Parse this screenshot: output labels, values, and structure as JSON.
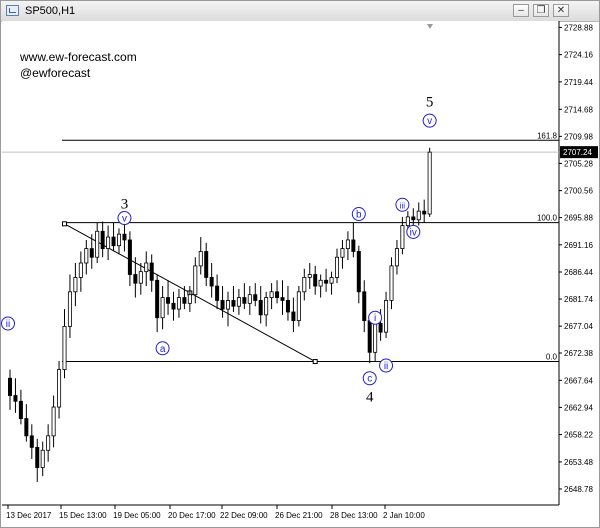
{
  "window": {
    "title": "SP500,H1",
    "buttons": {
      "minimize": "–",
      "restore": "❐",
      "close": "✕"
    }
  },
  "watermark": {
    "line1": "www.ew-forecast.com",
    "line2": "@ewforecast"
  },
  "chart_data": {
    "type": "candlestick",
    "symbol": "SP500,H1",
    "ylim": [
      2646.0,
      2730.0
    ],
    "y_ticks": [
      "2728.88",
      "2724.16",
      "2719.44",
      "2714.68",
      "2709.98",
      "2705.28",
      "2700.56",
      "2695.88",
      "2691.16",
      "2686.44",
      "2681.74",
      "2677.04",
      "2672.38",
      "2667.64",
      "2662.94",
      "2658.22",
      "2653.48",
      "2648.78"
    ],
    "x_ticks": [
      "13 Dec 2017",
      "15 Dec 13:00",
      "19 Dec 05:00",
      "20 Dec 17:00",
      "22 Dec 09:00",
      "26 Dec 21:00",
      "28 Dec 13:00",
      "2 Jan 10:00"
    ],
    "current_price": "2707.24",
    "fib_levels": [
      {
        "label": "161.8",
        "price": 2709.3
      },
      {
        "label": "100.0",
        "price": 2695.0
      },
      {
        "label": "0.0",
        "price": 2670.9
      }
    ],
    "wave_labels": [
      {
        "text": "3",
        "style": "plain",
        "bar": 21,
        "price": 2698.3
      },
      {
        "text": "v",
        "style": "circled",
        "bar": 21,
        "price": 2695.8
      },
      {
        "text": "a",
        "style": "circled",
        "bar": 28,
        "price": 2673.2
      },
      {
        "text": "ii",
        "style": "circled",
        "bar": -1,
        "price": 2677.5
      },
      {
        "text": "b",
        "style": "circled",
        "bar": 64,
        "price": 2696.5
      },
      {
        "text": "c",
        "style": "circled",
        "bar": 66,
        "price": 2668.0
      },
      {
        "text": "4",
        "style": "plain",
        "bar": 66,
        "price": 2664.8
      },
      {
        "text": "i",
        "style": "circled",
        "bar": 67,
        "price": 2678.5
      },
      {
        "text": "ii",
        "style": "circled",
        "bar": 69,
        "price": 2670.2
      },
      {
        "text": "iii",
        "style": "circled",
        "bar": 72,
        "price": 2698.1
      },
      {
        "text": "iv",
        "style": "circled",
        "bar": 74,
        "price": 2693.4
      },
      {
        "text": "5",
        "style": "plain",
        "bar": 77,
        "price": 2716.0
      },
      {
        "text": "v",
        "style": "circled",
        "bar": 77,
        "price": 2712.7
      }
    ],
    "trendline": {
      "from": {
        "bar": 10,
        "price": 2694.8
      },
      "to": {
        "bar": 56,
        "price": 2670.9
      },
      "mid": {
        "bar": 33,
        "price": 2682.8
      }
    },
    "candles": [
      {
        "o": 2668.0,
        "h": 2669.5,
        "l": 2662.5,
        "c": 2665.0
      },
      {
        "o": 2665.0,
        "h": 2668.0,
        "l": 2662.0,
        "c": 2664.0
      },
      {
        "o": 2664.0,
        "h": 2666.0,
        "l": 2660.0,
        "c": 2661.0
      },
      {
        "o": 2661.0,
        "h": 2663.5,
        "l": 2657.0,
        "c": 2658.0
      },
      {
        "o": 2658.0,
        "h": 2660.0,
        "l": 2654.0,
        "c": 2656.0
      },
      {
        "o": 2656.0,
        "h": 2657.5,
        "l": 2650.0,
        "c": 2652.5
      },
      {
        "o": 2652.5,
        "h": 2657.0,
        "l": 2651.0,
        "c": 2655.5
      },
      {
        "o": 2655.5,
        "h": 2660.0,
        "l": 2653.5,
        "c": 2658.0
      },
      {
        "o": 2658.0,
        "h": 2665.0,
        "l": 2656.0,
        "c": 2663.0
      },
      {
        "o": 2663.0,
        "h": 2671.0,
        "l": 2661.0,
        "c": 2669.5
      },
      {
        "o": 2669.5,
        "h": 2680.0,
        "l": 2668.0,
        "c": 2677.0
      },
      {
        "o": 2677.0,
        "h": 2686.0,
        "l": 2675.0,
        "c": 2683.0
      },
      {
        "o": 2683.0,
        "h": 2688.0,
        "l": 2680.5,
        "c": 2685.5
      },
      {
        "o": 2685.5,
        "h": 2690.0,
        "l": 2683.0,
        "c": 2688.0
      },
      {
        "o": 2688.0,
        "h": 2692.0,
        "l": 2686.0,
        "c": 2690.5
      },
      {
        "o": 2690.5,
        "h": 2693.0,
        "l": 2687.0,
        "c": 2689.0
      },
      {
        "o": 2689.0,
        "h": 2695.0,
        "l": 2688.0,
        "c": 2693.5
      },
      {
        "o": 2693.5,
        "h": 2695.2,
        "l": 2689.0,
        "c": 2690.5
      },
      {
        "o": 2690.5,
        "h": 2694.5,
        "l": 2688.5,
        "c": 2692.5
      },
      {
        "o": 2692.5,
        "h": 2695.0,
        "l": 2690.0,
        "c": 2691.0
      },
      {
        "o": 2691.0,
        "h": 2694.0,
        "l": 2689.5,
        "c": 2693.0
      },
      {
        "o": 2693.0,
        "h": 2695.3,
        "l": 2690.0,
        "c": 2692.0
      },
      {
        "o": 2692.0,
        "h": 2693.5,
        "l": 2684.0,
        "c": 2686.0
      },
      {
        "o": 2686.0,
        "h": 2689.0,
        "l": 2682.0,
        "c": 2684.5
      },
      {
        "o": 2684.5,
        "h": 2688.0,
        "l": 2682.5,
        "c": 2686.5
      },
      {
        "o": 2686.5,
        "h": 2690.0,
        "l": 2684.0,
        "c": 2688.0
      },
      {
        "o": 2688.0,
        "h": 2689.5,
        "l": 2683.0,
        "c": 2685.0
      },
      {
        "o": 2685.0,
        "h": 2686.0,
        "l": 2676.0,
        "c": 2678.5
      },
      {
        "o": 2678.5,
        "h": 2684.0,
        "l": 2676.5,
        "c": 2682.0
      },
      {
        "o": 2682.0,
        "h": 2685.0,
        "l": 2679.0,
        "c": 2681.0
      },
      {
        "o": 2681.0,
        "h": 2683.0,
        "l": 2678.0,
        "c": 2680.0
      },
      {
        "o": 2680.0,
        "h": 2683.5,
        "l": 2678.5,
        "c": 2682.0
      },
      {
        "o": 2682.0,
        "h": 2684.0,
        "l": 2680.0,
        "c": 2681.0
      },
      {
        "o": 2681.0,
        "h": 2684.0,
        "l": 2679.5,
        "c": 2682.5
      },
      {
        "o": 2682.5,
        "h": 2689.0,
        "l": 2681.0,
        "c": 2687.5
      },
      {
        "o": 2687.5,
        "h": 2692.5,
        "l": 2686.0,
        "c": 2690.0
      },
      {
        "o": 2690.0,
        "h": 2691.5,
        "l": 2684.0,
        "c": 2685.5
      },
      {
        "o": 2685.5,
        "h": 2688.0,
        "l": 2682.0,
        "c": 2684.0
      },
      {
        "o": 2684.0,
        "h": 2686.0,
        "l": 2680.0,
        "c": 2681.5
      },
      {
        "o": 2681.5,
        "h": 2684.0,
        "l": 2678.5,
        "c": 2680.0
      },
      {
        "o": 2680.0,
        "h": 2683.0,
        "l": 2677.0,
        "c": 2681.5
      },
      {
        "o": 2681.5,
        "h": 2684.0,
        "l": 2679.5,
        "c": 2680.5
      },
      {
        "o": 2680.5,
        "h": 2683.5,
        "l": 2679.0,
        "c": 2682.0
      },
      {
        "o": 2682.0,
        "h": 2684.5,
        "l": 2680.0,
        "c": 2681.0
      },
      {
        "o": 2681.0,
        "h": 2684.0,
        "l": 2679.0,
        "c": 2682.5
      },
      {
        "o": 2682.5,
        "h": 2684.5,
        "l": 2680.5,
        "c": 2681.5
      },
      {
        "o": 2681.5,
        "h": 2684.0,
        "l": 2677.5,
        "c": 2679.0
      },
      {
        "o": 2679.0,
        "h": 2683.0,
        "l": 2677.0,
        "c": 2682.0
      },
      {
        "o": 2682.0,
        "h": 2684.5,
        "l": 2680.0,
        "c": 2683.0
      },
      {
        "o": 2683.0,
        "h": 2685.0,
        "l": 2681.0,
        "c": 2682.0
      },
      {
        "o": 2682.0,
        "h": 2685.0,
        "l": 2679.0,
        "c": 2681.5
      },
      {
        "o": 2681.5,
        "h": 2684.0,
        "l": 2678.0,
        "c": 2679.5
      },
      {
        "o": 2679.5,
        "h": 2682.0,
        "l": 2676.0,
        "c": 2678.0
      },
      {
        "o": 2678.0,
        "h": 2684.0,
        "l": 2677.0,
        "c": 2683.0
      },
      {
        "o": 2683.0,
        "h": 2687.0,
        "l": 2681.5,
        "c": 2685.5
      },
      {
        "o": 2685.5,
        "h": 2688.0,
        "l": 2683.5,
        "c": 2686.0
      },
      {
        "o": 2686.0,
        "h": 2687.5,
        "l": 2682.5,
        "c": 2684.0
      },
      {
        "o": 2684.0,
        "h": 2686.0,
        "l": 2682.0,
        "c": 2685.0
      },
      {
        "o": 2685.0,
        "h": 2687.0,
        "l": 2683.0,
        "c": 2684.5
      },
      {
        "o": 2684.5,
        "h": 2686.5,
        "l": 2682.5,
        "c": 2685.5
      },
      {
        "o": 2685.5,
        "h": 2690.5,
        "l": 2684.5,
        "c": 2689.0
      },
      {
        "o": 2689.0,
        "h": 2692.0,
        "l": 2687.0,
        "c": 2690.5
      },
      {
        "o": 2690.5,
        "h": 2693.5,
        "l": 2688.5,
        "c": 2692.0
      },
      {
        "o": 2692.0,
        "h": 2695.0,
        "l": 2689.0,
        "c": 2690.0
      },
      {
        "o": 2690.0,
        "h": 2691.0,
        "l": 2681.0,
        "c": 2683.0
      },
      {
        "o": 2683.0,
        "h": 2685.0,
        "l": 2676.0,
        "c": 2678.0
      },
      {
        "o": 2678.0,
        "h": 2679.0,
        "l": 2670.6,
        "c": 2672.5
      },
      {
        "o": 2672.5,
        "h": 2679.5,
        "l": 2671.0,
        "c": 2677.5
      },
      {
        "o": 2677.5,
        "h": 2680.0,
        "l": 2674.5,
        "c": 2676.0
      },
      {
        "o": 2676.0,
        "h": 2683.0,
        "l": 2675.0,
        "c": 2681.5
      },
      {
        "o": 2681.5,
        "h": 2689.0,
        "l": 2680.0,
        "c": 2687.5
      },
      {
        "o": 2687.5,
        "h": 2692.0,
        "l": 2686.0,
        "c": 2690.5
      },
      {
        "o": 2690.5,
        "h": 2696.0,
        "l": 2689.5,
        "c": 2694.5
      },
      {
        "o": 2694.5,
        "h": 2697.0,
        "l": 2693.5,
        "c": 2696.0
      },
      {
        "o": 2696.0,
        "h": 2697.5,
        "l": 2694.5,
        "c": 2695.5
      },
      {
        "o": 2695.5,
        "h": 2698.5,
        "l": 2694.5,
        "c": 2697.0
      },
      {
        "o": 2697.0,
        "h": 2699.0,
        "l": 2695.0,
        "c": 2696.5
      },
      {
        "o": 2696.5,
        "h": 2708.0,
        "l": 2696.0,
        "c": 2707.24
      }
    ]
  }
}
